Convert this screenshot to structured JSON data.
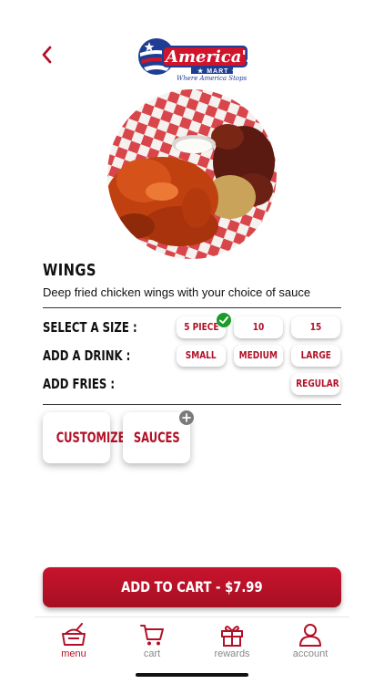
{
  "header": {
    "logo": {
      "brand": "America's",
      "sub": "MART",
      "tagline": "Where America Stops"
    }
  },
  "icons": {
    "back": "chevron-left-icon"
  },
  "product": {
    "title": "WINGS",
    "description": "Deep fried chicken wings with your choice of sauce"
  },
  "options": {
    "size": {
      "label": "SELECT A SIZE :",
      "choices": [
        "5 PIECE",
        "10 PIECE",
        "15 PIECE"
      ],
      "selected": "5 PIECE"
    },
    "drink": {
      "label": "ADD A DRINK :",
      "choices": [
        "SMALL",
        "MEDIUM",
        "LARGE"
      ]
    },
    "fries": {
      "label": "ADD FRIES :",
      "choices": [
        "REGULAR"
      ]
    }
  },
  "extras": {
    "customize": "CUSTOMIZE",
    "sauces": "SAUCES"
  },
  "cart_button": "ADD TO CART - $7.99",
  "tabs": [
    {
      "label": "menu",
      "icon": "menu-icon",
      "active": true
    },
    {
      "label": "cart",
      "icon": "cart-icon",
      "active": false
    },
    {
      "label": "rewards",
      "icon": "gift-icon",
      "active": false
    },
    {
      "label": "account",
      "icon": "user-icon",
      "active": false
    }
  ],
  "colors": {
    "accent": "#b21127",
    "check": "#1a9c2a",
    "inactive": "#888888"
  }
}
